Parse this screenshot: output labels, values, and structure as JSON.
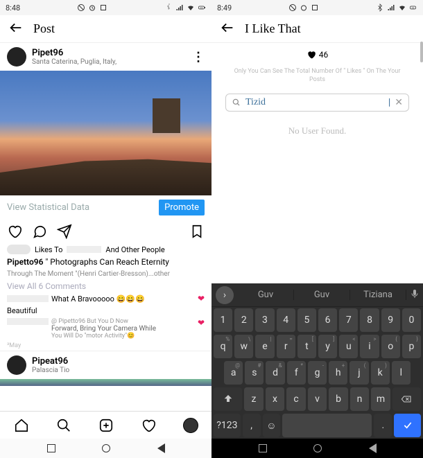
{
  "left": {
    "status": {
      "time": "8:48"
    },
    "header": {
      "title": "Post"
    },
    "user": {
      "name": "Pipet96",
      "location": "Santa Caterina, Puglia, Italy,"
    },
    "stats": {
      "view": "View Statistical Data",
      "promote": "Promote"
    },
    "likes": {
      "to": "Likes To",
      "others": "And Other People"
    },
    "caption": {
      "user": "Pipetto96",
      "text": "\" Photographs Can Reach Eternity",
      "thru": "Through The Moment \"(Henri Cartier-Bresson)...other"
    },
    "viewcomments": "View All 6 Comments",
    "c1": {
      "text": "What A Bravooooo 😄😄😄"
    },
    "c2": {
      "text": "Beautiful"
    },
    "c3": {
      "handle": "@ Pipetto96 But You D Now",
      "line1": "Forward, Bring Your Camera While",
      "line2": "You Will Do \"motor Activity\"😊"
    },
    "time": "³May",
    "user2": {
      "name": "Pipeat96",
      "location": "Palascia Tio"
    }
  },
  "right": {
    "status": {
      "time": "8:49"
    },
    "header": {
      "title": "I Like That"
    },
    "likes": {
      "count": "46"
    },
    "info": "Only You Can See The Total Number Of \" Likes \" On The Your Posts",
    "search": {
      "value": "Tizid",
      "cursor": "|"
    },
    "nouser": "No User Found.",
    "sugg": {
      "w1": "Guv",
      "w2": "Guv",
      "w3": "Tiziana"
    },
    "rows": {
      "num": [
        "1",
        "2",
        "3",
        "4",
        "5",
        "6",
        "7",
        "8",
        "9",
        "0"
      ],
      "r2": [
        "q",
        "w",
        "e",
        "r",
        "t",
        "y",
        "u",
        "i",
        "o",
        "p"
      ],
      "r2s": [
        "%",
        "\\",
        "|",
        "=",
        "[",
        "]",
        "<",
        ">",
        "{",
        "}"
      ],
      "r3": [
        "a",
        "s",
        "d",
        "f",
        "g",
        "h",
        "j",
        "k",
        "l"
      ],
      "r3s": [
        "@",
        "#",
        "&",
        "*",
        "-",
        "+",
        "(",
        ")",
        ""
      ],
      "r4": [
        "z",
        "x",
        "c",
        "v",
        "b",
        "n",
        "m"
      ],
      "bottom": {
        "sym": "?123",
        "comma": ",",
        "period": "."
      }
    }
  }
}
